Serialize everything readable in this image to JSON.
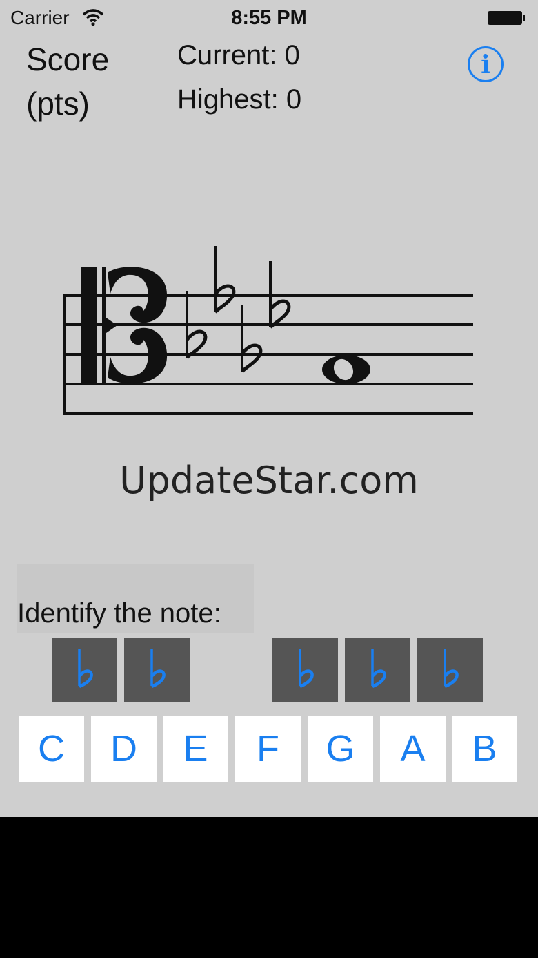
{
  "status_bar": {
    "carrier": "Carrier",
    "time": "8:55 PM"
  },
  "score": {
    "label_line1": "Score",
    "label_line2": "(pts)",
    "current": "Current: 0",
    "highest": "Highest: 0"
  },
  "info_icon": "info-icon",
  "staff": {
    "clef": "alto-clef",
    "key_signature_flats": 4,
    "note": "whole-note"
  },
  "watermark": "UpdateStar.com",
  "prompt": "Identify the note:",
  "accidental_buttons": [
    "flat",
    "flat",
    "flat",
    "flat",
    "flat"
  ],
  "note_buttons": [
    "C",
    "D",
    "E",
    "F",
    "G",
    "A",
    "B"
  ],
  "colors": {
    "accent": "#1a7ff0",
    "background": "#cfcfcf",
    "accidental_bg": "#555555"
  }
}
